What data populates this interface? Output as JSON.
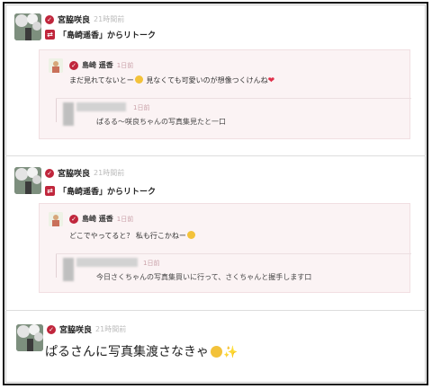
{
  "post1": {
    "author": "宮脇咲良",
    "time": "21時間前",
    "retalk": "「島崎遥香」からリトーク",
    "quote": {
      "author": "島崎 遥香",
      "time": "1日前",
      "text": "まだ見れてないとー",
      "text_after": "見なくても可愛いのが想像つくけんね",
      "nested_time": "1日前",
      "nested_text": "ぱるる〜咲良ちゃんの写真集見たと一口"
    }
  },
  "post2": {
    "author": "宮脇咲良",
    "time": "21時間前",
    "retalk": "「島崎遥香」からリトーク",
    "quote": {
      "author": "島崎 遥香",
      "time": "1日前",
      "text": "どこでやってると？ 私も行こかねー",
      "nested_time": "1日前",
      "nested_text": "今日さくちゃんの写真集買いに行って、さくちゃんと握手します口"
    }
  },
  "post3": {
    "author": "宮脇咲良",
    "time": "21時間前",
    "text": "ぱるさんに写真集渡さなきゃ"
  },
  "colors": {
    "accent": "#c0263c",
    "quote_bg": "#fbf3f4",
    "muted": "#bbbbbb"
  },
  "icons": [
    "verified-badge-icon",
    "retalk-icon",
    "smiley-emoji-icon",
    "heart-emoji-icon",
    "sparkles-emoji-icon"
  ]
}
